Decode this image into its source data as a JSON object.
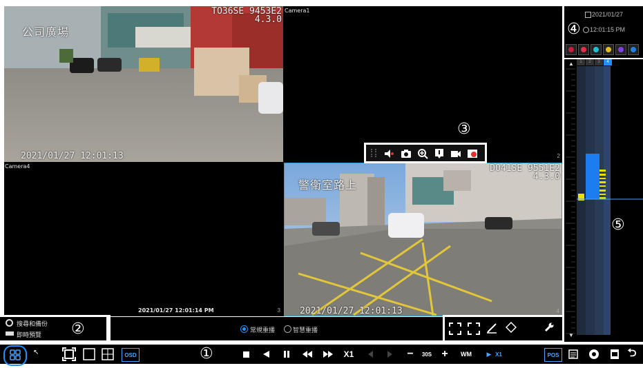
{
  "cameras": [
    {
      "id": "1",
      "label": "",
      "osd_title": "公司廣場",
      "osd_id_line1": "TO36SE 9453E2",
      "osd_id_line2": "4.3.0",
      "osd_date": "2021/01/27 12:01:13",
      "tile_number": ""
    },
    {
      "id": "2",
      "label": "Camera1",
      "tile_number": "2"
    },
    {
      "id": "3",
      "label": "Camera4",
      "timestamp": "2021/01/27 12:01:14 PM",
      "tile_number": "3"
    },
    {
      "id": "4",
      "label": "",
      "osd_title": "警衛室路上",
      "osd_id_line1": "DO41SE 9551E2",
      "osd_id_line2": "4.3.0",
      "osd_date": "2021/01/27 12:01:13",
      "tile_number": "4"
    }
  ],
  "annotations": {
    "a1": "①",
    "a2": "②",
    "a3": "③",
    "a4": "④",
    "a5": "⑤"
  },
  "left_panel": {
    "search_backup": "搜尋和備份",
    "live_preview": "即時預覽"
  },
  "playback_mode": {
    "normal": "常規重播",
    "smart": "智慧重播",
    "selected": "normal"
  },
  "clock": {
    "date": "2021/01/27",
    "time": "12:01:15 PM"
  },
  "timeline": {
    "channels": [
      "1",
      "2",
      "3",
      "4"
    ],
    "active_channel": "4"
  },
  "toolbar": {
    "osd": "OSD",
    "speed": "X1",
    "skip_interval": "30S",
    "play_speed": "X1",
    "pos": "POS",
    "watermark": "WM"
  },
  "colors": {
    "accent": "#1e90ff",
    "timeline_bar": "#1c7cf0",
    "event_yellow": "#e8e000",
    "cursor_line": "#4aa3ff"
  },
  "status_icons": [
    {
      "name": "alarm-in-icon",
      "color": "#c0203a"
    },
    {
      "name": "alarm-out-icon",
      "color": "#e0304a"
    },
    {
      "name": "motion-icon",
      "color": "#20c0d0"
    },
    {
      "name": "sensor-icon",
      "color": "#e0c020"
    },
    {
      "name": "intelligent-icon",
      "color": "#8040e0"
    },
    {
      "name": "disk-icon",
      "color": "#2080e0"
    }
  ]
}
